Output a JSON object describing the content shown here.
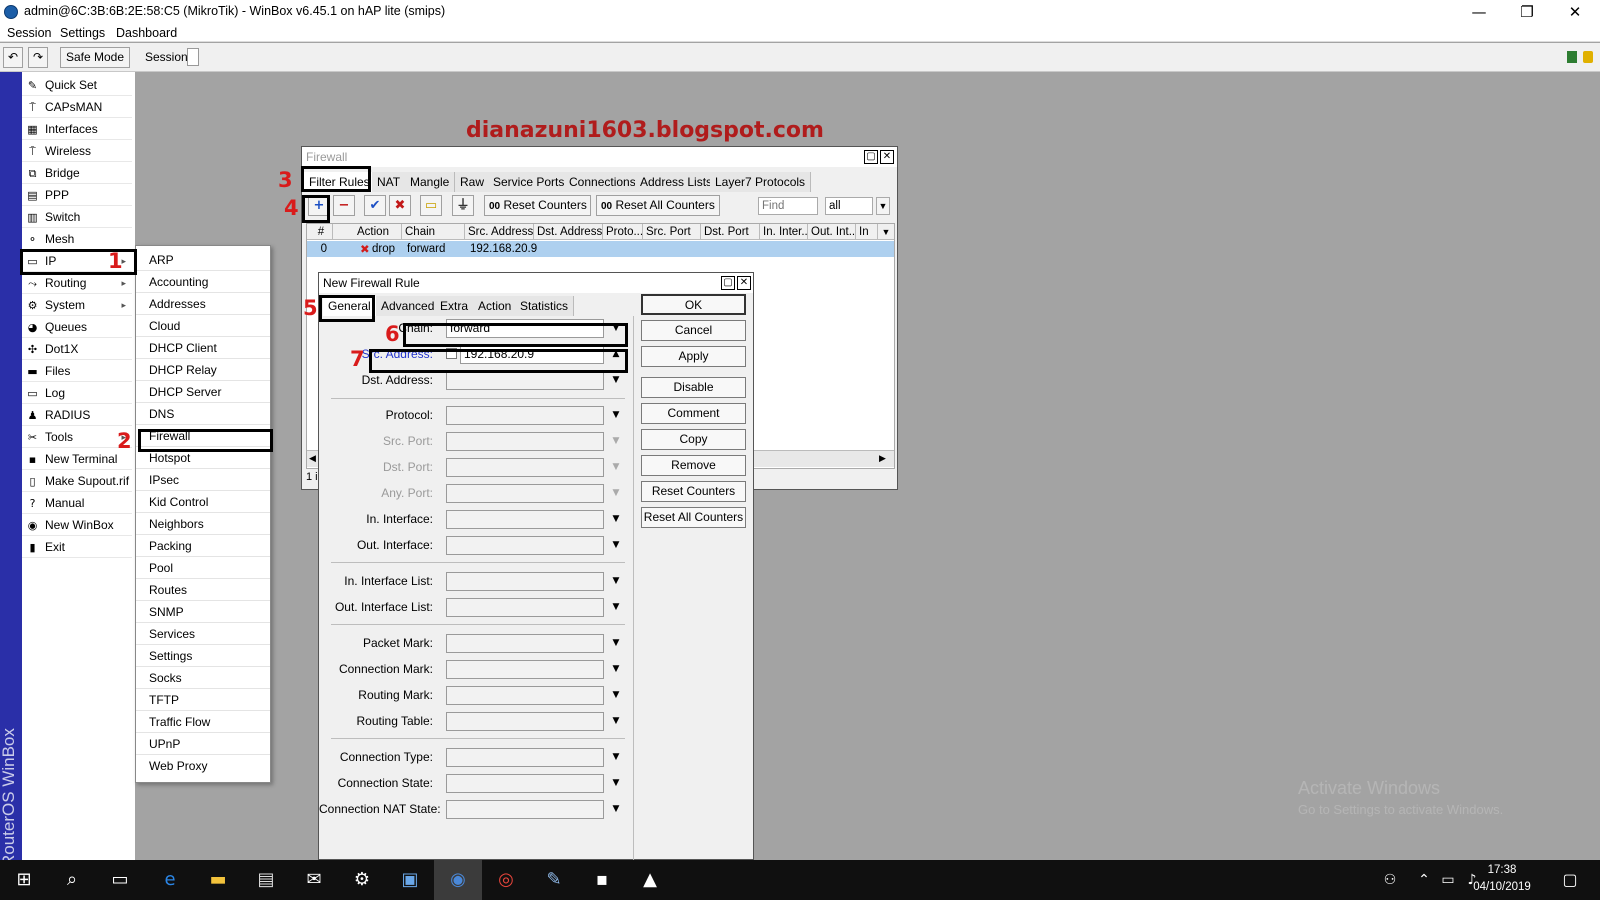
{
  "window": {
    "title": "admin@6C:3B:6B:2E:58:C5 (MikroTik) - WinBox v6.45.1 on hAP lite (smips)",
    "minimize": "—",
    "maximize": "❐",
    "close": "✕"
  },
  "menubar": [
    "Session",
    "Settings",
    "Dashboard"
  ],
  "toolbar": {
    "undo": "↶",
    "redo": "↷",
    "safe_mode": "Safe Mode",
    "session_label": "Session:"
  },
  "sidebar": {
    "brand": "RouterOS WinBox",
    "items": [
      {
        "label": "Quick Set",
        "icon": "quick-set-icon",
        "glyph": "✎"
      },
      {
        "label": "CAPsMAN",
        "icon": "capsman-icon",
        "glyph": "⍑"
      },
      {
        "label": "Interfaces",
        "icon": "interfaces-icon",
        "glyph": "▦"
      },
      {
        "label": "Wireless",
        "icon": "wireless-icon",
        "glyph": "⍑"
      },
      {
        "label": "Bridge",
        "icon": "bridge-icon",
        "glyph": "⧉"
      },
      {
        "label": "PPP",
        "icon": "ppp-icon",
        "glyph": "▤"
      },
      {
        "label": "Switch",
        "icon": "switch-icon",
        "glyph": "▥"
      },
      {
        "label": "Mesh",
        "icon": "mesh-icon",
        "glyph": "⚬"
      },
      {
        "label": "IP",
        "icon": "ip-icon",
        "glyph": "▭",
        "arrow": "▸"
      },
      {
        "label": "Routing",
        "icon": "routing-icon",
        "glyph": "⤳",
        "arrow": "▸"
      },
      {
        "label": "System",
        "icon": "system-icon",
        "glyph": "⚙",
        "arrow": "▸"
      },
      {
        "label": "Queues",
        "icon": "queues-icon",
        "glyph": "◕"
      },
      {
        "label": "Dot1X",
        "icon": "dot1x-icon",
        "glyph": "✣"
      },
      {
        "label": "Files",
        "icon": "files-icon",
        "glyph": "▬"
      },
      {
        "label": "Log",
        "icon": "log-icon",
        "glyph": "▭"
      },
      {
        "label": "RADIUS",
        "icon": "radius-icon",
        "glyph": "♟"
      },
      {
        "label": "Tools",
        "icon": "tools-icon",
        "glyph": "✂",
        "arrow": "▸"
      },
      {
        "label": "New Terminal",
        "icon": "terminal-icon",
        "glyph": "▪"
      },
      {
        "label": "Make Supout.rif",
        "icon": "supout-icon",
        "glyph": "▯"
      },
      {
        "label": "Manual",
        "icon": "manual-icon",
        "glyph": "?"
      },
      {
        "label": "New WinBox",
        "icon": "winbox-icon",
        "glyph": "◉"
      },
      {
        "label": "Exit",
        "icon": "exit-icon",
        "glyph": "▮"
      }
    ]
  },
  "ip_submenu": [
    "ARP",
    "Accounting",
    "Addresses",
    "Cloud",
    "DHCP Client",
    "DHCP Relay",
    "DHCP Server",
    "DNS",
    "Firewall",
    "Hotspot",
    "IPsec",
    "Kid Control",
    "Neighbors",
    "Packing",
    "Pool",
    "Routes",
    "SNMP",
    "Services",
    "Settings",
    "Socks",
    "TFTP",
    "Traffic Flow",
    "UPnP",
    "Web Proxy"
  ],
  "annotation_text": "dianazuni1603.blogspot.com",
  "step_numbers": [
    "1",
    "2",
    "3",
    "4",
    "5",
    "6",
    "7"
  ],
  "firewall": {
    "title": "Firewall",
    "tabs": [
      "Filter Rules",
      "NAT",
      "Mangle",
      "Raw",
      "Service Ports",
      "Connections",
      "Address Lists",
      "Layer7 Protocols"
    ],
    "toolbar": {
      "reset_counters": "Reset Counters",
      "reset_all_counters": "Reset All Counters",
      "counter_glyph": "00",
      "find_placeholder": "Find",
      "filter_value": "all"
    },
    "columns": [
      "#",
      "Action",
      "Chain",
      "Src. Address",
      "Dst. Address",
      "Proto...",
      "Src. Port",
      "Dst. Port",
      "In. Inter...",
      "Out. Int...",
      "In"
    ],
    "rows": [
      {
        "num": "0",
        "action": "drop",
        "chain": "forward",
        "src": "192.168.20.9"
      }
    ],
    "status": "1 i"
  },
  "new_rule": {
    "title": "New Firewall Rule",
    "tabs": [
      "General",
      "Advanced",
      "Extra",
      "Action",
      "Statistics"
    ],
    "fields": {
      "chain": {
        "label": "Chain:",
        "value": "forward"
      },
      "src_address": {
        "label": "Src. Address:",
        "value": "192.168.20.9"
      },
      "dst_address": {
        "label": "Dst. Address:"
      },
      "protocol": {
        "label": "Protocol:"
      },
      "src_port": {
        "label": "Src. Port:"
      },
      "dst_port": {
        "label": "Dst. Port:"
      },
      "any_port": {
        "label": "Any. Port:"
      },
      "in_interface": {
        "label": "In. Interface:"
      },
      "out_interface": {
        "label": "Out. Interface:"
      },
      "in_interface_list": {
        "label": "In. Interface List:"
      },
      "out_interface_list": {
        "label": "Out. Interface List:"
      },
      "packet_mark": {
        "label": "Packet Mark:"
      },
      "connection_mark": {
        "label": "Connection Mark:"
      },
      "routing_mark": {
        "label": "Routing Mark:"
      },
      "routing_table": {
        "label": "Routing Table:"
      },
      "connection_type": {
        "label": "Connection Type:"
      },
      "connection_state": {
        "label": "Connection State:"
      },
      "connection_nat_state": {
        "label": "Connection NAT State:"
      }
    },
    "buttons": [
      "OK",
      "Cancel",
      "Apply",
      "Disable",
      "Comment",
      "Copy",
      "Remove",
      "Reset Counters",
      "Reset All Counters"
    ]
  },
  "watermark": {
    "line1": "Activate Windows",
    "line2": "Go to Settings to activate Windows."
  },
  "taskbar": {
    "time": "17:38",
    "date": "04/10/2019"
  },
  "colors": {
    "sidebar_strip": "#2a2fa8",
    "highlight_row": "#aed0ef",
    "annotation_red": "#d91b1b",
    "taskbar": "#101010"
  }
}
